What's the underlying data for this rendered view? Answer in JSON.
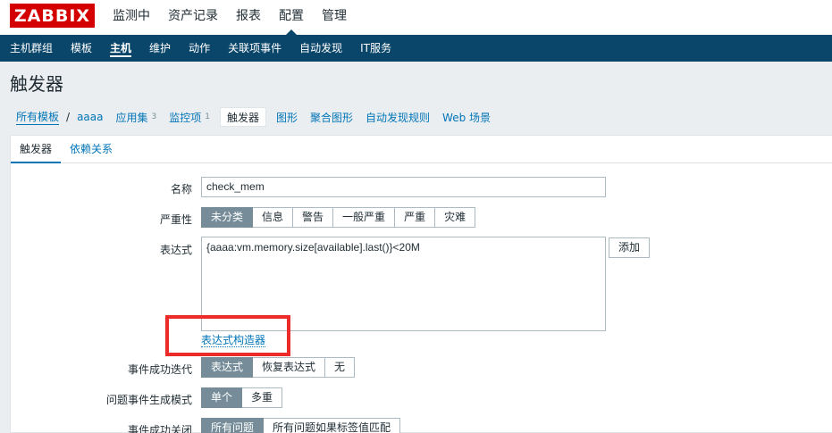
{
  "header": {
    "logo": "ZABBIX",
    "menu": [
      "监测中",
      "资产记录",
      "报表",
      "配置",
      "管理"
    ]
  },
  "subnav": [
    "主机群组",
    "模板",
    "主机",
    "维护",
    "动作",
    "关联项事件",
    "自动发现",
    "IT服务"
  ],
  "page": {
    "title": "触发器"
  },
  "breadcrumb": {
    "all_templates": "所有模板",
    "separator": "/",
    "template": "aaaa",
    "apps": "应用集",
    "apps_count": "3",
    "items": "监控项",
    "items_count": "1",
    "triggers": "触发器",
    "graphs": "图形",
    "screens": "聚合图形",
    "discovery": "自动发现规则",
    "web": "Web 场景"
  },
  "tabs": [
    "触发器",
    "依赖关系"
  ],
  "form": {
    "name_label": "名称",
    "name_value": "check_mem",
    "severity_label": "严重性",
    "severity_options": [
      "未分类",
      "信息",
      "警告",
      "一般严重",
      "严重",
      "灾难"
    ],
    "expression_label": "表达式",
    "expression_value": "{aaaa:vm.memory.size[available].last()}<20M",
    "add_button": "添加",
    "constructor_link": "表达式构造器",
    "ok_event_label": "事件成功迭代",
    "ok_event_options": [
      "表达式",
      "恢复表达式",
      "无"
    ],
    "mode_label": "问题事件生成模式",
    "mode_options": [
      "单个",
      "多重"
    ],
    "close_label": "事件成功关闭",
    "close_options": [
      "所有问题",
      "所有问题如果标签值匹配"
    ]
  },
  "colors": {
    "brand": "#d40000",
    "nav": "#0a466a",
    "link": "#0275b8",
    "highlight": "#ee2b2b"
  }
}
